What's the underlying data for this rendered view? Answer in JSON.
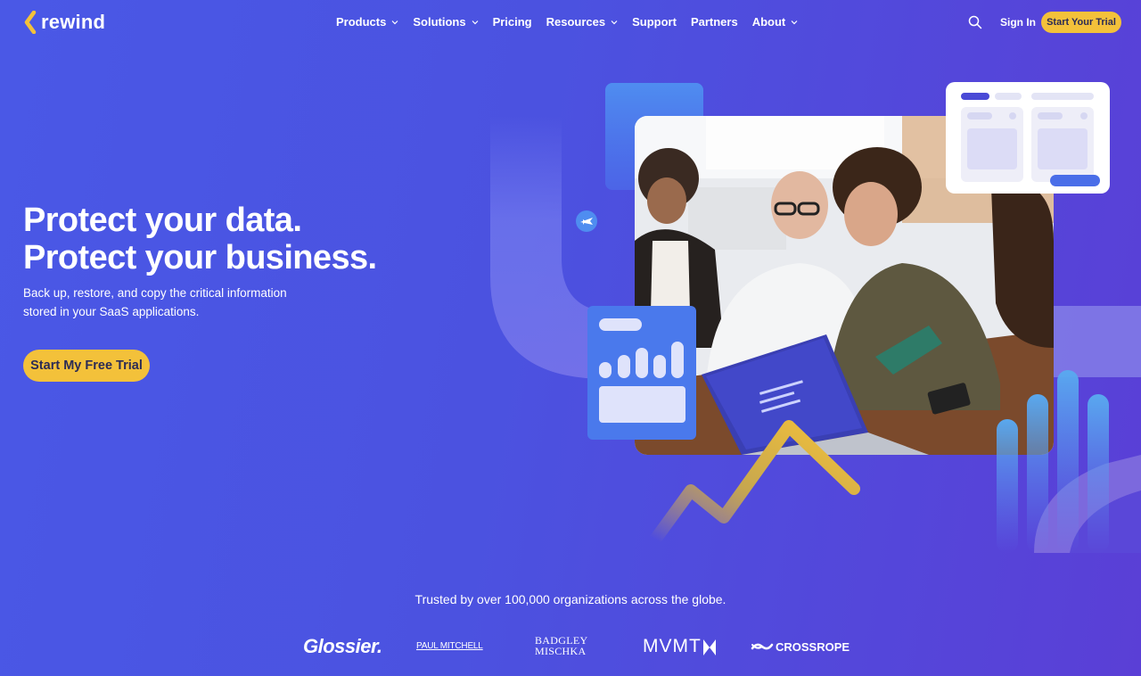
{
  "brand": {
    "name": "rewind",
    "accent": "#f3c13a"
  },
  "nav": {
    "items": [
      {
        "label": "Products",
        "dropdown": true
      },
      {
        "label": "Solutions",
        "dropdown": true
      },
      {
        "label": "Pricing",
        "dropdown": false
      },
      {
        "label": "Resources",
        "dropdown": true
      },
      {
        "label": "Support",
        "dropdown": false
      },
      {
        "label": "Partners",
        "dropdown": false
      },
      {
        "label": "About",
        "dropdown": true
      }
    ],
    "search_icon": "search-icon",
    "sign_in": "Sign In",
    "cta": "Start Your Trial"
  },
  "hero": {
    "title_line1": "Protect your data.",
    "title_line2": "Protect your business.",
    "subtitle": "Back up, restore, and copy the critical information stored in your SaaS applications.",
    "cta": "Start My Free Trial"
  },
  "trusted": {
    "text": "Trusted by over 100,000 organizations across the globe.",
    "logos": [
      "Glossier.",
      "PAUL MITCHELL",
      "BADGLEY MISCHKA",
      "MVMT",
      "CROSSROPE"
    ]
  },
  "colors": {
    "bg_start": "#4a58e6",
    "bg_end": "#5a3fd6",
    "cta": "#f3c13a"
  }
}
